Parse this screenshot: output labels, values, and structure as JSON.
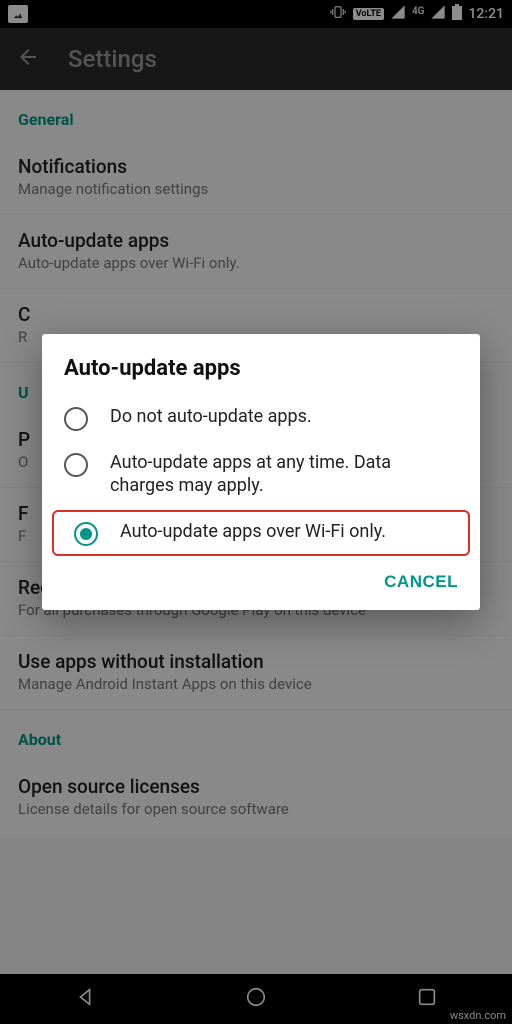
{
  "status": {
    "volte": "VoLTE",
    "network": "4G",
    "time": "12:21"
  },
  "header": {
    "title": "Settings"
  },
  "sections": {
    "general": "General",
    "user": "U",
    "about": "About"
  },
  "items": {
    "notifications": {
      "title": "Notifications",
      "sub": "Manage notification settings"
    },
    "autoupdate": {
      "title": "Auto-update apps",
      "sub": "Auto-update apps over Wi-Fi only."
    },
    "clear": {
      "title": "C",
      "sub": "R"
    },
    "parental": {
      "title": "P",
      "sub": "O"
    },
    "fingerprint": {
      "title": "F",
      "sub": "F"
    },
    "auth": {
      "title": "Require authentication for purchases",
      "sub": "For all purchases through Google Play on this device"
    },
    "instant": {
      "title": "Use apps without installation",
      "sub": "Manage Android Instant Apps on this device"
    },
    "oss": {
      "title": "Open source licenses",
      "sub": "License details for open source software"
    }
  },
  "dialog": {
    "title": "Auto-update apps",
    "options": [
      "Do not auto-update apps.",
      "Auto-update apps at any time. Data charges may apply.",
      "Auto-update apps over Wi-Fi only."
    ],
    "cancel": "CANCEL"
  },
  "watermark": "wsxdn.com"
}
